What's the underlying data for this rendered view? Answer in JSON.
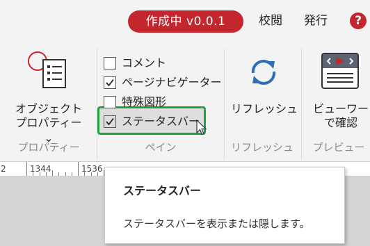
{
  "header": {
    "status": "作成中 v0.0.1",
    "menu": [
      "校閲",
      "発行"
    ],
    "help": "?"
  },
  "ribbon": {
    "properties": {
      "button_line1": "オブジェクト",
      "button_line2": "プロパティー ⌄",
      "group_label": "プロパティー"
    },
    "pane": {
      "options": [
        {
          "label": "コメント",
          "checked": false
        },
        {
          "label": "ページナビゲーター",
          "checked": true
        },
        {
          "label": "特殊図形",
          "checked": false
        },
        {
          "label": "ステータスバー",
          "checked": true
        }
      ],
      "group_label": "ペイン"
    },
    "refresh": {
      "button_label": "リフレッシュ",
      "group_label": "リフレッシュ"
    },
    "preview": {
      "button_line1": "ビューワー",
      "button_line2": "で確認",
      "group_label": "プレビュー"
    }
  },
  "ruler": {
    "labels": [
      "2",
      "1344",
      "1536"
    ]
  },
  "tooltip": {
    "title": "ステータスバー",
    "description": "ステータスバーを表示または隠します。"
  },
  "colors": {
    "accent_red": "#c4262e",
    "highlight_green": "#21a33b",
    "refresh_blue": "#2f6db5"
  }
}
